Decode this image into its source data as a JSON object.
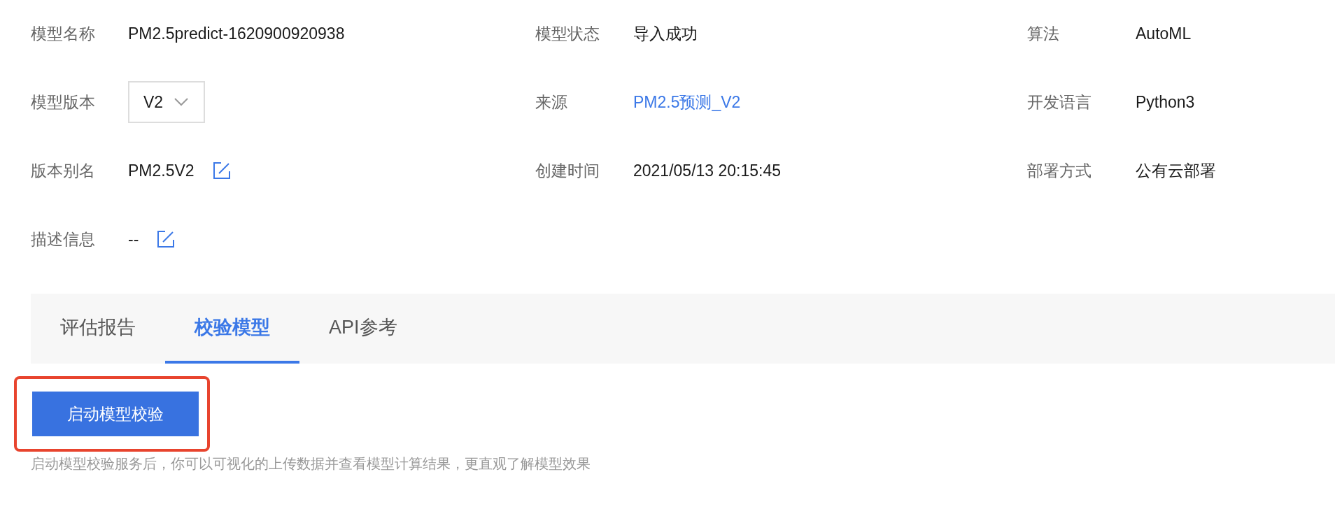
{
  "rows": [
    [
      {
        "label": "模型名称",
        "kind": "text",
        "value": "PM2.5predict-1620900920938"
      },
      {
        "label": "模型状态",
        "kind": "text",
        "value": "导入成功"
      },
      {
        "label": "算法",
        "kind": "text",
        "value": "AutoML"
      }
    ],
    [
      {
        "label": "模型版本",
        "kind": "select",
        "value": "V2"
      },
      {
        "label": "来源",
        "kind": "link",
        "value": "PM2.5预测_V2"
      },
      {
        "label": "开发语言",
        "kind": "text",
        "value": "Python3"
      }
    ],
    [
      {
        "label": "版本别名",
        "kind": "editable",
        "value": "PM2.5V2"
      },
      {
        "label": "创建时间",
        "kind": "text",
        "value": "2021/05/13 20:15:45"
      },
      {
        "label": "部署方式",
        "kind": "text",
        "value": "公有云部署"
      }
    ],
    [
      {
        "label": "描述信息",
        "kind": "editable",
        "value": "--"
      }
    ]
  ],
  "tabs": [
    {
      "label": "评估报告",
      "selected": false
    },
    {
      "label": "校验模型",
      "selected": true
    },
    {
      "label": "API参考",
      "selected": false
    }
  ],
  "action": {
    "label": "启动模型校验",
    "highlighted": true
  },
  "hint": "启动模型校验服务后，你可以可视化的上传数据并查看模型计算结果，更直观了解模型效果"
}
